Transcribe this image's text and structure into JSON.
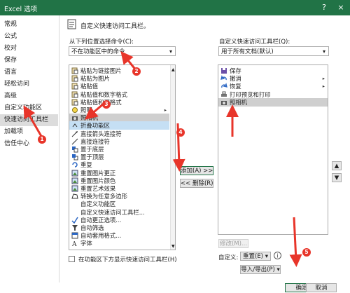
{
  "window": {
    "title": "Excel 选项",
    "help": "?",
    "close": "×"
  },
  "sidebar": {
    "items": [
      {
        "label": "常规"
      },
      {
        "label": "公式"
      },
      {
        "label": "校对"
      },
      {
        "label": "保存"
      },
      {
        "label": "语言"
      },
      {
        "label": "轻松访问"
      },
      {
        "label": "高级"
      },
      {
        "label": "自定义功能区"
      },
      {
        "label": "快速访问工具栏",
        "selected": true
      },
      {
        "label": "加载项"
      },
      {
        "label": "信任中心"
      }
    ]
  },
  "main": {
    "heading": "自定义快速访问工具栏。",
    "left_label": "从下列位置选择命令(C):",
    "left_select": "不在功能区中的命令",
    "right_label": "自定义快速访问工具栏(Q):",
    "right_select": "用于所有文档(默认)",
    "commands": [
      {
        "label": "粘贴为链接图片",
        "icon": "paste-icon"
      },
      {
        "label": "粘贴为图片",
        "icon": "paste-icon"
      },
      {
        "label": "粘贴值",
        "icon": "paste-icon"
      },
      {
        "label": "粘贴值和数字格式",
        "icon": "paste-icon"
      },
      {
        "label": "粘贴值和源格式",
        "icon": "paste-icon"
      },
      {
        "label": "照明",
        "icon": "lighting-icon",
        "submenu": true
      },
      {
        "label": "照相机",
        "icon": "camera-icon",
        "selected": true
      },
      {
        "label": "折叠功能区",
        "icon": "collapse-icon"
      },
      {
        "label": "直接箭头连接符",
        "icon": "arrow-connector-icon"
      },
      {
        "label": "直接连接符",
        "icon": "connector-icon"
      },
      {
        "label": "置于底层",
        "icon": "send-back-icon"
      },
      {
        "label": "置于顶层",
        "icon": "bring-front-icon"
      },
      {
        "label": "重复",
        "icon": "repeat-icon"
      },
      {
        "label": "重置图片更正",
        "icon": "picture-icon"
      },
      {
        "label": "重置图片颜色",
        "icon": "picture-icon"
      },
      {
        "label": "重置艺术效果",
        "icon": "picture-icon"
      },
      {
        "label": "转换为任意多边形",
        "icon": "polygon-icon"
      },
      {
        "label": "自定义功能区",
        "icon": ""
      },
      {
        "label": "自定义快速访问工具栏...",
        "icon": ""
      },
      {
        "label": "自动更正选项...",
        "icon": "autocorrect-icon"
      },
      {
        "label": "自动筛选",
        "icon": "filter-icon"
      },
      {
        "label": "自动套用格式...",
        "icon": "autoformat-icon"
      },
      {
        "label": "字体",
        "icon": "font-icon"
      }
    ],
    "qat": [
      {
        "label": "保存",
        "icon": "save-icon"
      },
      {
        "label": "撤消",
        "icon": "undo-icon",
        "submenu": true
      },
      {
        "label": "恢复",
        "icon": "redo-icon",
        "submenu": true
      },
      {
        "label": "打印预览和打印",
        "icon": "print-icon"
      },
      {
        "label": "照相机",
        "icon": "camera-icon",
        "selected": true
      }
    ],
    "add_button": "添加(A) >>",
    "remove_button": "<< 删除(R)",
    "modify_button": "修改(M)...",
    "customize_label": "自定义:",
    "reset_button": "重置(E) ▾",
    "import_export_button": "导入/导出(P) ▾",
    "show_below_checkbox": "在功能区下方显示快速访问工具栏(H)",
    "ok_button": "确定",
    "cancel_button": "取消"
  },
  "annotations": [
    {
      "n": "1"
    },
    {
      "n": "2"
    },
    {
      "n": "3"
    },
    {
      "n": "4"
    },
    {
      "n": "5"
    }
  ],
  "colors": {
    "titlebar": "#217346",
    "annotation": "#e8352a",
    "selection": "#cfcfcf",
    "highlight": "#c5dff4"
  }
}
